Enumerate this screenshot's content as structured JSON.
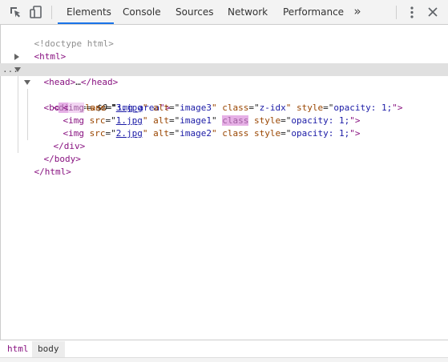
{
  "toolbar": {
    "inspect_icon": "inspect-element-icon",
    "device_icon": "device-toolbar-icon",
    "tabs": [
      {
        "label": "Elements",
        "active": true
      },
      {
        "label": "Console",
        "active": false
      },
      {
        "label": "Sources",
        "active": false
      },
      {
        "label": "Network",
        "active": false
      },
      {
        "label": "Performance",
        "active": false
      }
    ],
    "more_tabs": "»",
    "menu_icon": "kebab-menu-icon",
    "close_icon": "close-icon",
    "active_color": "#1a73e8"
  },
  "dom": {
    "doctype": "<!doctype html>",
    "html_open": "<html>",
    "head": {
      "open": "<head>",
      "ellipsis": "…",
      "close": "</head>"
    },
    "body": {
      "open_lt": "<",
      "tag": "body",
      "open_gt": ">",
      "eq": " == ",
      "var": "$0",
      "dots": "..."
    },
    "div": {
      "lt": "<",
      "tag": "div",
      "attr": " class",
      "eq": "=\"",
      "val": "img_area",
      "end": "\">"
    },
    "img_rows": [
      {
        "lt": "<",
        "tag": "img",
        "src_label": " src",
        "src_eq": "=\"",
        "src": "3.jpg",
        "alt_label": "\" alt",
        "alt_eq": "=\"",
        "alt": "image3",
        "class_label": "\" class",
        "class_eq": "=\"",
        "class_val": "z-idx",
        "style_label": "\" style",
        "style_eq": "=\"",
        "style_val": "opacity: 1;",
        "end": "\">"
      },
      {
        "lt": "<",
        "tag": "img",
        "src_label": " src",
        "src_eq": "=\"",
        "src": "1.jpg",
        "alt_label": "\" alt",
        "alt_eq": "=\"",
        "alt": "image1",
        "class_label": "class",
        "style_label": " style",
        "style_eq": "=\"",
        "style_val": "opacity: 1;",
        "end": "\">"
      },
      {
        "lt": "<",
        "tag": "img",
        "src_label": " src",
        "src_eq": "=\"",
        "src": "2.jpg",
        "alt_label": "\" alt",
        "alt_eq": "=\"",
        "alt": "image2",
        "class_label": "\" class",
        "style_label": " style",
        "style_eq": "=\"",
        "style_val": "opacity: 1;",
        "end": "\">"
      }
    ],
    "div_close": "</div>",
    "body_close": "</body>",
    "html_close": "</html>"
  },
  "breadcrumbs": [
    "html",
    "body"
  ]
}
